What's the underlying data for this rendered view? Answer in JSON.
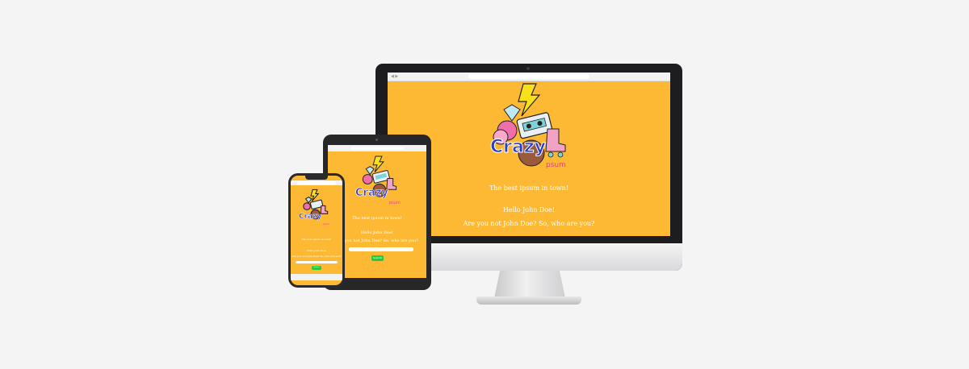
{
  "desktop": {
    "tagline": "The best ipsum in town!",
    "greeting": "Hello John Doe!",
    "question": "Are you not John Doe? So, who are you?",
    "logo": "Crazy",
    "logo_sub": "psum"
  },
  "tablet": {
    "tagline": "The best ipsum in town!",
    "greeting": "Hello John Doe!",
    "question": "Are you not John Doe? So, who are you?",
    "submit": "Submit",
    "logo": "Crazy",
    "logo_sub": "psum"
  },
  "phone": {
    "tagline": "The best ipsum in town!",
    "greeting": "Hello John Doe!",
    "question": "Are you not John Doe? So, who are you?",
    "submit": "Submit",
    "logo": "Crazy",
    "logo_sub": "psum"
  },
  "colors": {
    "background": "#f4f4f4",
    "screen_yellow": "#fdb933",
    "logo_blue": "#2e3ec4",
    "logo_pink": "#e8418b",
    "submit_green": "#27c93f"
  },
  "icons": [
    "lightning-icon",
    "diamond-icon",
    "cassette-icon",
    "ice-cream-icon",
    "donut-icon",
    "roller-skate-icon"
  ]
}
